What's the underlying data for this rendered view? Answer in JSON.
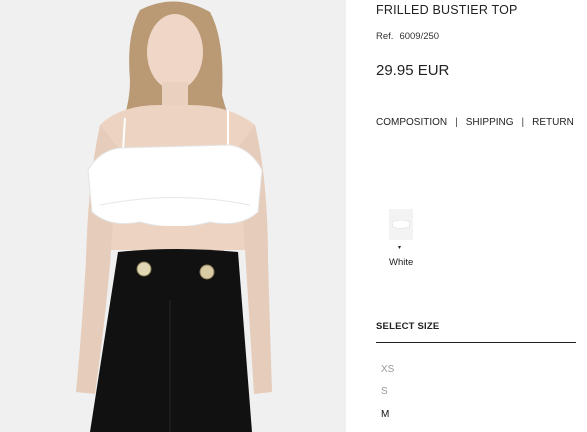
{
  "product": {
    "title": "FRILLED BUSTIER TOP",
    "ref_label": "Ref.",
    "ref_value": "6009/250",
    "price": "29.95 EUR"
  },
  "info_links": [
    {
      "label": "COMPOSITION"
    },
    {
      "label": "SHIPPING"
    },
    {
      "label": "RETURN"
    }
  ],
  "link_separator": "|",
  "colors": {
    "selected_label": "White",
    "arrow_glyph": "▾"
  },
  "size_section": {
    "heading": "SELECT SIZE",
    "sizes": [
      {
        "label": "XS",
        "available": false
      },
      {
        "label": "S",
        "available": false
      },
      {
        "label": "M",
        "available": true
      }
    ]
  },
  "palette": {
    "text": "#222222",
    "disabled": "#999999",
    "photo_bg": "#efefef"
  }
}
